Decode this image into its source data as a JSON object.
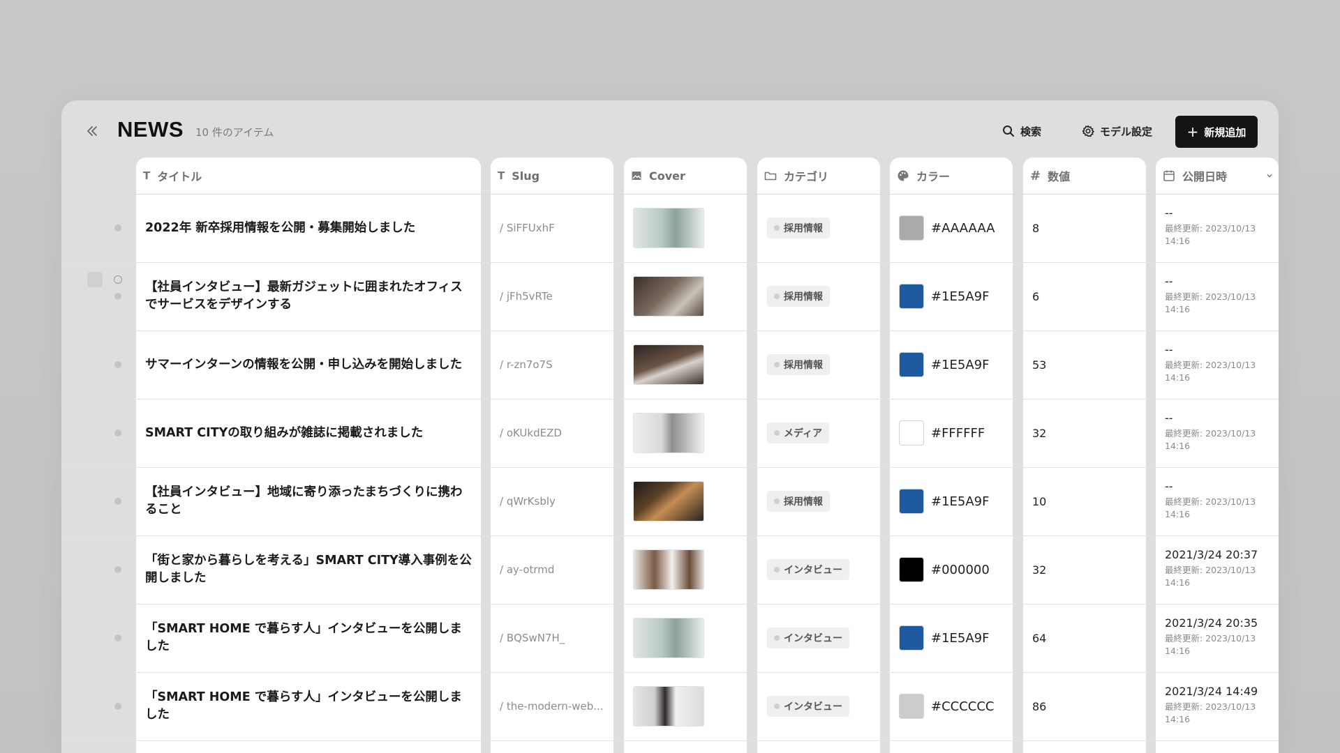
{
  "header": {
    "title": "NEWS",
    "item_count": "10 件のアイテム",
    "search_label": "検索",
    "model_settings_label": "モデル設定",
    "add_label": "新規追加"
  },
  "columns": {
    "title": "タイトル",
    "slug": "Slug",
    "cover": "Cover",
    "category": "カテゴリ",
    "color": "カラー",
    "number": "数値",
    "published": "公開日時"
  },
  "rows": [
    {
      "title": "2022年 新卒採用情報を公開・募集開始しました",
      "slug": "/ SiFFUxhF",
      "category": "採用情報",
      "color": "#AAAAAA",
      "number": "8",
      "published": "--",
      "updated": "最終更新: 2023/10/13",
      "updated_time": "14:16"
    },
    {
      "title": "【社員インタビュー】最新ガジェットに囲まれたオフィスでサービスをデザインする",
      "slug": "/ jFh5vRTe",
      "category": "採用情報",
      "color": "#1E5A9F",
      "number": "6",
      "published": "--",
      "updated": "最終更新: 2023/10/13",
      "updated_time": "14:16"
    },
    {
      "title": "サマーインターンの情報を公開・申し込みを開始しました",
      "slug": "/ r-zn7o7S",
      "category": "採用情報",
      "color": "#1E5A9F",
      "number": "53",
      "published": "--",
      "updated": "最終更新: 2023/10/13",
      "updated_time": "14:16"
    },
    {
      "title": "SMART CITYの取り組みが雑誌に掲載されました",
      "slug": "/ oKUkdEZD",
      "category": "メディア",
      "color": "#FFFFFF",
      "number": "32",
      "published": "--",
      "updated": "最終更新: 2023/10/13",
      "updated_time": "14:16"
    },
    {
      "title": "【社員インタビュー】地域に寄り添ったまちづくりに携わること",
      "slug": "/ qWrKsbly",
      "category": "採用情報",
      "color": "#1E5A9F",
      "number": "10",
      "published": "--",
      "updated": "最終更新: 2023/10/13",
      "updated_time": "14:16"
    },
    {
      "title": "「街と家から暮らしを考える」SMART CITY導入事例を公開しました",
      "slug": "/ ay-otrmd",
      "category": "インタビュー",
      "color": "#000000",
      "number": "32",
      "published": "2021/3/24 20:37",
      "updated": "最終更新: 2023/10/13",
      "updated_time": "14:16"
    },
    {
      "title": "「SMART HOME で暮らす人」インタビューを公開しました",
      "slug": "/ BQSwN7H_",
      "category": "インタビュー",
      "color": "#1E5A9F",
      "number": "64",
      "published": "2021/3/24 20:35",
      "updated": "最終更新: 2023/10/13",
      "updated_time": "14:16"
    },
    {
      "title": "「SMART HOME で暮らす人」インタビューを公開しました",
      "slug": "/ the-modern-web...",
      "category": "インタビュー",
      "color": "#CCCCCC",
      "number": "86",
      "published": "2021/3/24 14:49",
      "updated": "最終更新: 2023/10/13",
      "updated_time": "14:16"
    }
  ]
}
